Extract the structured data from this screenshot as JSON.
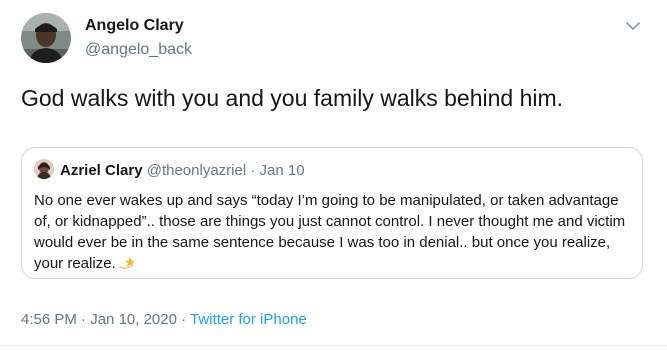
{
  "author": {
    "name": "Angelo Clary",
    "handle": "@angelo_back"
  },
  "tweet": {
    "text": "God walks with you and you family walks behind him."
  },
  "quoted_tweet": {
    "name": "Azriel Clary",
    "handle": "@theonlyazriel",
    "separator": "·",
    "date": "Jan 10",
    "text": "No one ever wakes up and says “today I’m going to be manipulated, or taken advantage of, or kidnapped”.. those are things you just cannot control. I never thought me and victim would ever be in the same sentence because I was too in denial.. but once you realize, your realize."
  },
  "meta": {
    "time": "4:56 PM",
    "separator": "·",
    "date": "Jan 10, 2020",
    "source": "Twitter for iPhone"
  },
  "icons": {
    "caret": "chevron-down-icon",
    "emoji": "dizzy-star-emoji"
  },
  "colors": {
    "text": "#14171a",
    "secondary": "#657786",
    "link": "#1da1f2",
    "border": "#ccd6dd"
  }
}
